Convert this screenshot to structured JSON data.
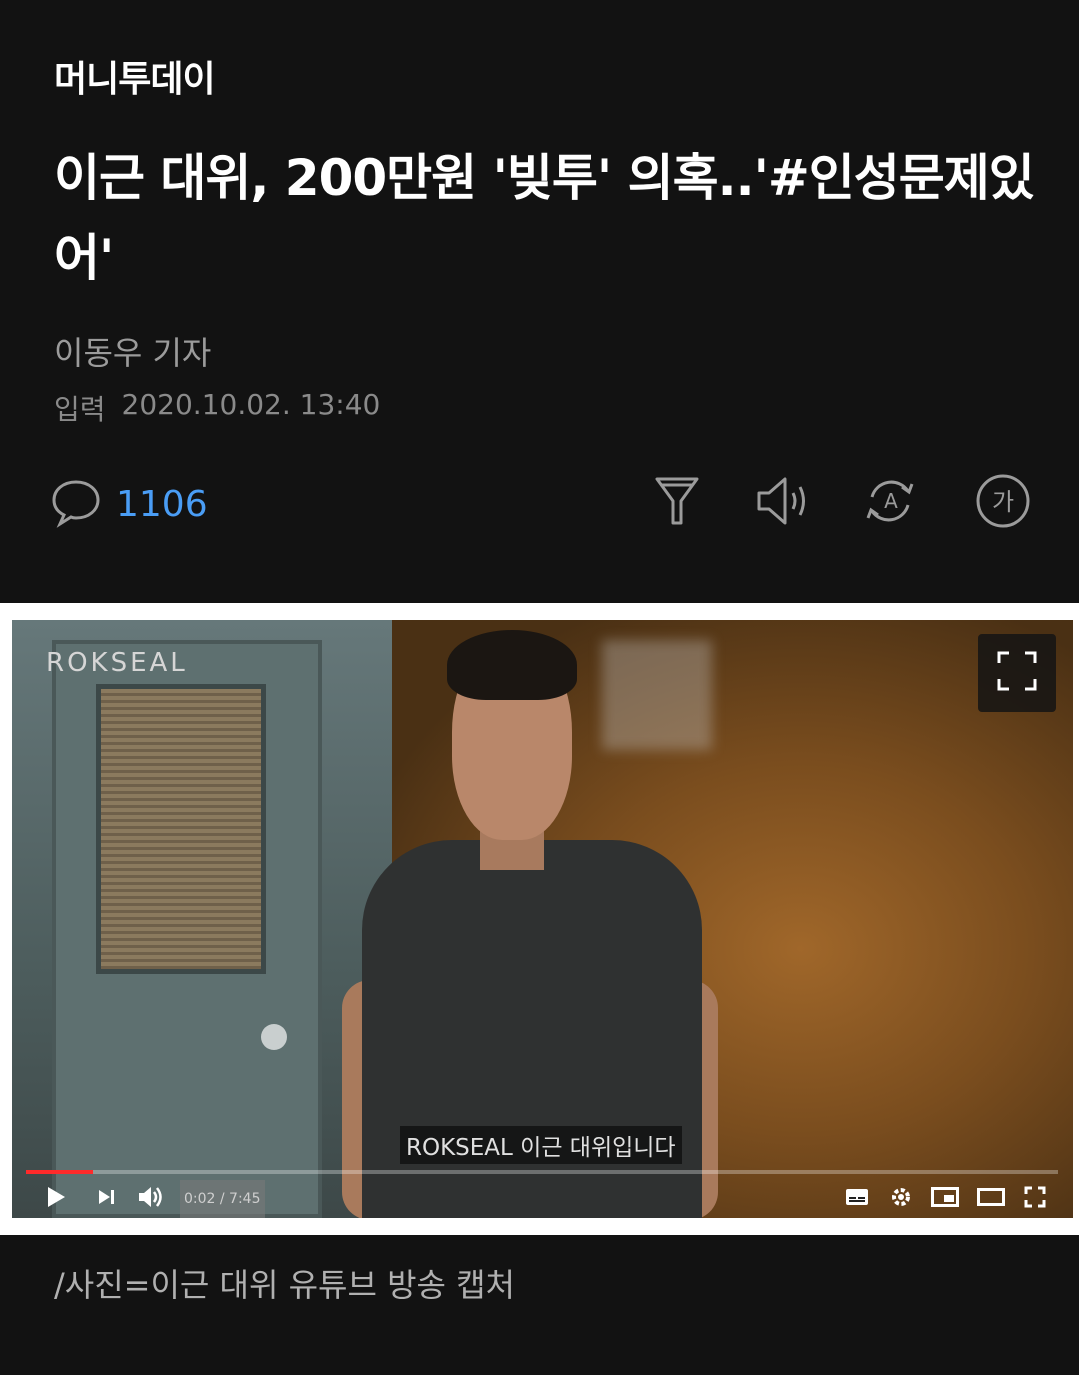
{
  "brand": "머니투데이",
  "article": {
    "title": "이근 대위, 200만원 '빚투' 의혹..'#인성문제있어'",
    "author": "이동우 기자",
    "input_label": "입력",
    "input_time": "2020.10.02. 13:40"
  },
  "toolbar": {
    "comment_count": "1106",
    "icons": [
      "comment-icon",
      "filter-icon",
      "speaker-icon",
      "translate-icon",
      "font-size-icon"
    ],
    "font_icon_text": "가",
    "translate_icon_text": "A",
    "accent_color": "#4a9df5"
  },
  "video": {
    "channel_logo": "ROKSEAL",
    "subtitle": "ROKSEAL 이근 대위입니다",
    "time": "0:02 / 7:45",
    "progress": 0.0043
  },
  "caption": "/사진=이근 대위 유튜브 방송 캡처"
}
